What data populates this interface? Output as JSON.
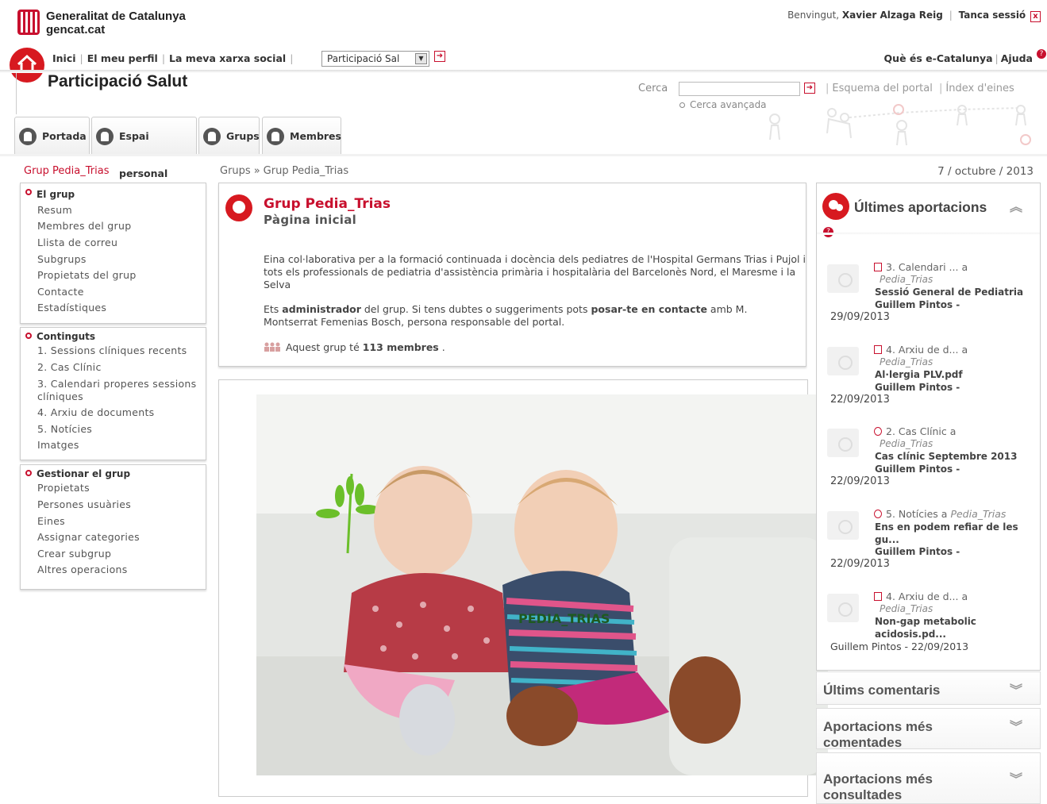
{
  "header": {
    "org_name": "Generalitat de Catalunya",
    "org_domain": "gencat.cat",
    "welcome_text": "Benvingut,",
    "user_name": "Xavier Alzaga Reig",
    "logout_label": "Tanca sessió",
    "logout_x": "x"
  },
  "nav": {
    "items": [
      "Inici",
      "El meu perfil",
      "La meva xarxa social"
    ],
    "select_value": "Participació Sal",
    "right_items": [
      "Què és e-Catalunya",
      "Ajuda"
    ]
  },
  "portal": {
    "title": "Participació Salut",
    "search_label": "Cerca",
    "search_value": "",
    "advanced_search": "Cerca avançada",
    "links": [
      "Esquema del portal",
      "Índex d'eines"
    ]
  },
  "tabs": [
    "Portada",
    "Espai personal",
    "Grups",
    "Membres"
  ],
  "left": {
    "title": "Grup Pedia_Trias",
    "sections": [
      {
        "head": "El grup",
        "items": [
          "Resum",
          "Membres del grup",
          "Llista de correu",
          "Subgrups",
          "Propietats del grup",
          "Contacte",
          "Estadístiques"
        ]
      },
      {
        "head": "Continguts",
        "items": [
          "1. Sessions clíniques recents",
          "2. Cas Clínic",
          "3. Calendari properes sessions",
          "clíniques",
          "4. Arxiu de documents",
          "5. Notícies",
          "Imatges"
        ]
      },
      {
        "head": "Gestionar el grup",
        "items": [
          "Propietats",
          "Persones usuàries",
          "Eines",
          "Assignar categories",
          "Crear subgrup",
          "Altres operacions"
        ]
      }
    ]
  },
  "breadcrumb": [
    "Grups",
    "Grup Pedia_Trias"
  ],
  "breadcrumb_sep": "»",
  "date": "7 / octubre / 2013",
  "main": {
    "title": "Grup Pedia_Trias",
    "subtitle": "Pàgina inicial",
    "description": "Eina col·laborativa per a la formació continuada i docència dels pediatres de l'Hospital Germans Trias i Pujol i tots els professionals de pediatria d'assistència primària i hospitalària del Barcelonès Nord, el Maresme i la Selva",
    "admin_1": "Ets",
    "admin_role": "administrador",
    "admin_2": "del grup. Si tens dubtes o suggeriments pots",
    "admin_link": "posar-te en contacte",
    "admin_3": "amb M. Montserrat Femenias Bosch, persona responsable del portal.",
    "members_pre": "Aquest grup té",
    "members_count": "113 membres",
    "members_post": ".",
    "photo_caption": "PEDIA_TRIAS"
  },
  "right": {
    "title": "Últimes aportacions",
    "contributions": [
      {
        "line1": "3. Calendari ... a",
        "space": "Pedia_Trias",
        "title": "Sessió General de Pediatria",
        "author": "Guillem Pintos -",
        "date": "29/09/2013"
      },
      {
        "line1": "4. Arxiu de d... a",
        "space": "Pedia_Trias",
        "title": "Al·lergia PLV.pdf",
        "author": "Guillem Pintos -",
        "date": "22/09/2013"
      },
      {
        "line1": "2. Cas Clínic a",
        "space": "Pedia_Trias",
        "title": "Cas clínic Septembre 2013",
        "author": "Guillem Pintos -",
        "date": "22/09/2013"
      },
      {
        "line1": "5. Notícies a",
        "space": "Pedia_Trias",
        "title": "Ens en podem refiar de les",
        "title2": "gu...",
        "author": "Guillem Pintos -",
        "date": "22/09/2013"
      },
      {
        "line1": "4. Arxiu de d... a",
        "space": "Pedia_Trias",
        "title": "Non-gap metabolic",
        "title2": "acidosis.pd...",
        "author": "Guillem Pintos - 22/09/2013"
      }
    ],
    "collapsed": [
      {
        "line1": "Últims comentaris"
      },
      {
        "line1": "Aportacions més",
        "line2": "comentades"
      },
      {
        "line1": "Aportacions més",
        "line2": "consultades"
      }
    ]
  },
  "colors": {
    "accent": "#c8102e",
    "text": "#333333",
    "border": "#cccccc"
  },
  "icons": [
    "generalitat-logo-icon",
    "home-icon",
    "tab-person-icon",
    "group-icon",
    "speech-bubble-icon",
    "chevron-up-icon",
    "chevron-down-icon"
  ]
}
